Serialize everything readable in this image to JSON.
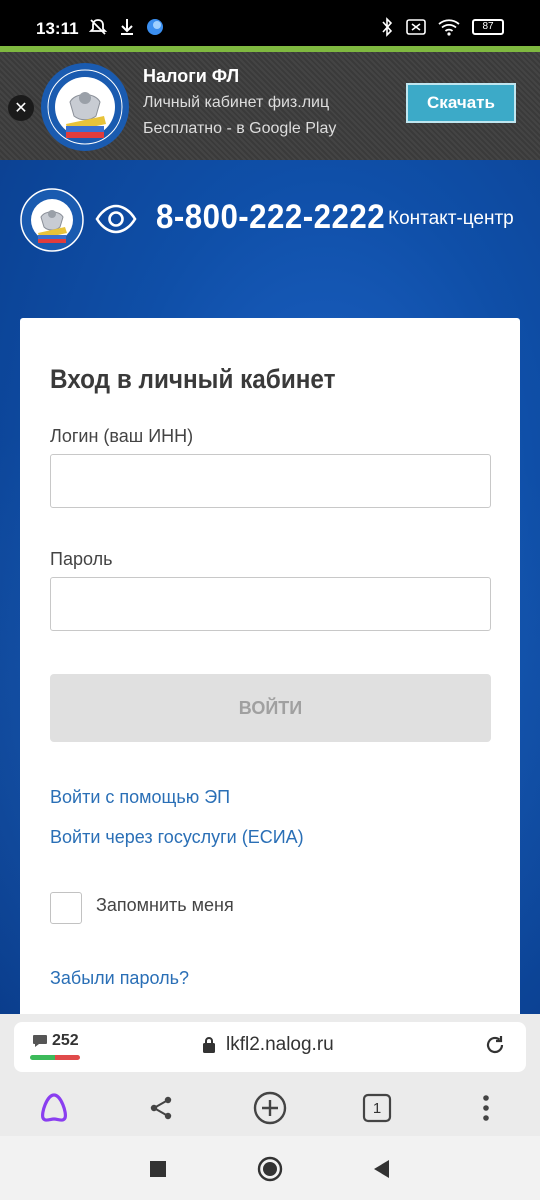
{
  "status_bar": {
    "time": "13:11",
    "battery": "87"
  },
  "app_banner": {
    "close_label": "✕",
    "title": "Налоги ФЛ",
    "subtitle": "Личный кабинет физ.лиц",
    "store_note": "Бесплатно - в Google Play",
    "download_label": "Скачать"
  },
  "header": {
    "phone": "8-800-222-2222",
    "contact_label": "Контакт-центр"
  },
  "login_form": {
    "title": "Вход в личный кабинет",
    "login_label": "Логин (ваш ИНН)",
    "login_value": "",
    "password_label": "Пароль",
    "password_value": "",
    "submit_label": "ВОЙТИ",
    "link_ep": "Войти с помощью ЭП",
    "link_esia": "Войти через госуслуги (ЕСИА)",
    "remember_label": "Запомнить меня",
    "remember_checked": false,
    "forgot_label": "Забыли пароль?"
  },
  "browser": {
    "comment_count": "252",
    "url": "lkfl2.nalog.ru",
    "tabs_count": "1"
  },
  "colors": {
    "accent_green": "#7fb840",
    "hero_blue": "#0f4fa8",
    "link_blue": "#2a6fb6",
    "download_button": "#3caac8",
    "alice_purple": "#8a3ef0"
  },
  "icons": [
    "mute-bell-icon",
    "download-icon",
    "browser-app-icon",
    "bluetooth-icon",
    "sim-icon",
    "wifi-icon",
    "battery-icon",
    "close-icon",
    "fns-emblem-icon",
    "eye-icon",
    "comment-icon",
    "lock-icon",
    "reload-icon",
    "alice-icon",
    "share-icon",
    "new-tab-icon",
    "tabs-icon",
    "menu-dots-icon",
    "recent-apps-icon",
    "home-icon",
    "back-icon"
  ]
}
